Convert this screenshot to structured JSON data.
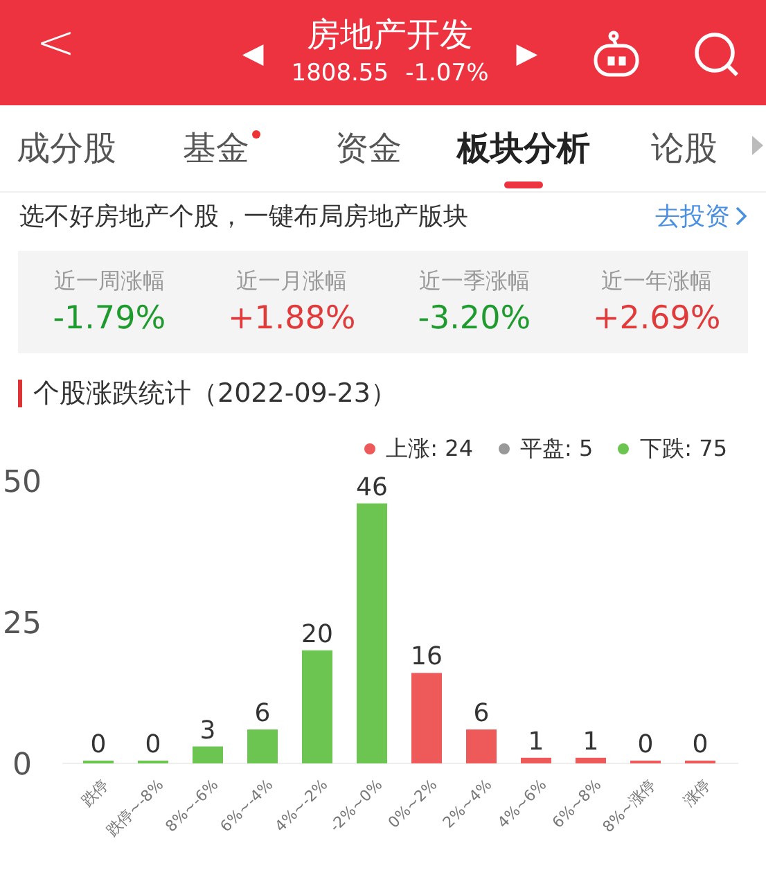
{
  "header": {
    "back": "<",
    "title": "房地产开发",
    "prev": "◀",
    "next": "▶",
    "price": "1808.55",
    "change": "-1.07%"
  },
  "tabs": [
    {
      "label": "成分股",
      "selected": false,
      "dot": false
    },
    {
      "label": "基金",
      "selected": false,
      "dot": true
    },
    {
      "label": "资金",
      "selected": false,
      "dot": false
    },
    {
      "label": "板块分析",
      "selected": true,
      "dot": false
    },
    {
      "label": "论股",
      "selected": false,
      "dot": false
    }
  ],
  "promo": {
    "text": "选不好房地产个股，一键布局房地产版块",
    "link": "去投资"
  },
  "stats": [
    {
      "label": "近一周涨幅",
      "value": "-1.79%",
      "color": "#1e9a2e"
    },
    {
      "label": "近一月涨幅",
      "value": "+1.88%",
      "color": "#e03a3a"
    },
    {
      "label": "近一季涨幅",
      "value": "-3.20%",
      "color": "#1e9a2e"
    },
    {
      "label": "近一年涨幅",
      "value": "+2.69%",
      "color": "#e03a3a"
    }
  ],
  "section_title": "个股涨跌统计（2022-09-23）",
  "legend": [
    {
      "label": "上涨: 24",
      "color": "#ee5a5a"
    },
    {
      "label": "平盘: 5",
      "color": "#999999"
    },
    {
      "label": "下跌: 75",
      "color": "#6cc551"
    }
  ],
  "chart_data": {
    "type": "bar",
    "categories": [
      "跌停",
      "跌停~-8%",
      "8%~-6%",
      "6%~-4%",
      "4%~-2%",
      "-2%~0%",
      "0%~2%",
      "2%~4%",
      "4%~6%",
      "6%~8%",
      "8%~涨停",
      "涨停"
    ],
    "series": [
      {
        "color": "#6cc551",
        "values": [
          0,
          0,
          3,
          6,
          20,
          46,
          null,
          null,
          null,
          null,
          null,
          null
        ]
      },
      {
        "color": "#ee5a5a",
        "values": [
          null,
          null,
          null,
          null,
          null,
          null,
          16,
          6,
          1,
          1,
          0,
          0
        ]
      }
    ],
    "ylim": [
      0,
      50
    ],
    "yticks": [
      0,
      25,
      50
    ],
    "data_labels": true
  }
}
